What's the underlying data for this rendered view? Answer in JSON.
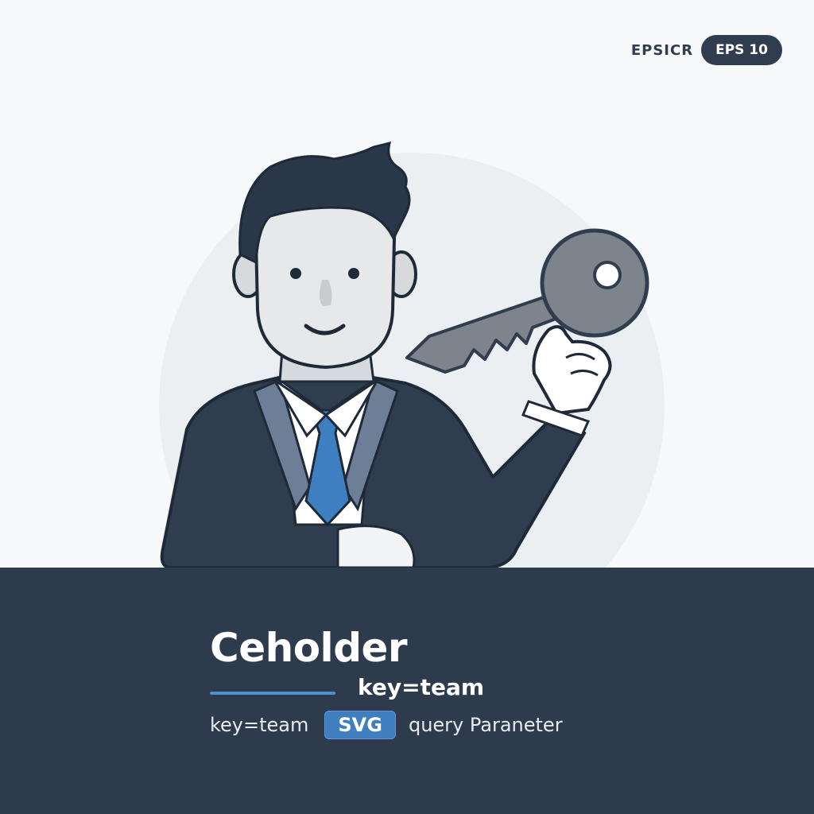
{
  "header": {
    "brand": "EPSICR",
    "format_badge": "EPS 10"
  },
  "footer": {
    "title": "Ceholder",
    "subtitle": "key=team",
    "caption_left": "key=team",
    "chip_label": "SVG",
    "caption_right": "query Paraneter"
  },
  "colors": {
    "navy": "#2d3b4d",
    "accent_blue": "#3f7fc0",
    "key_gray": "#7f868e",
    "background": "#f7f8f9"
  },
  "icons": {
    "main": "businessman-holding-key-illustration"
  }
}
